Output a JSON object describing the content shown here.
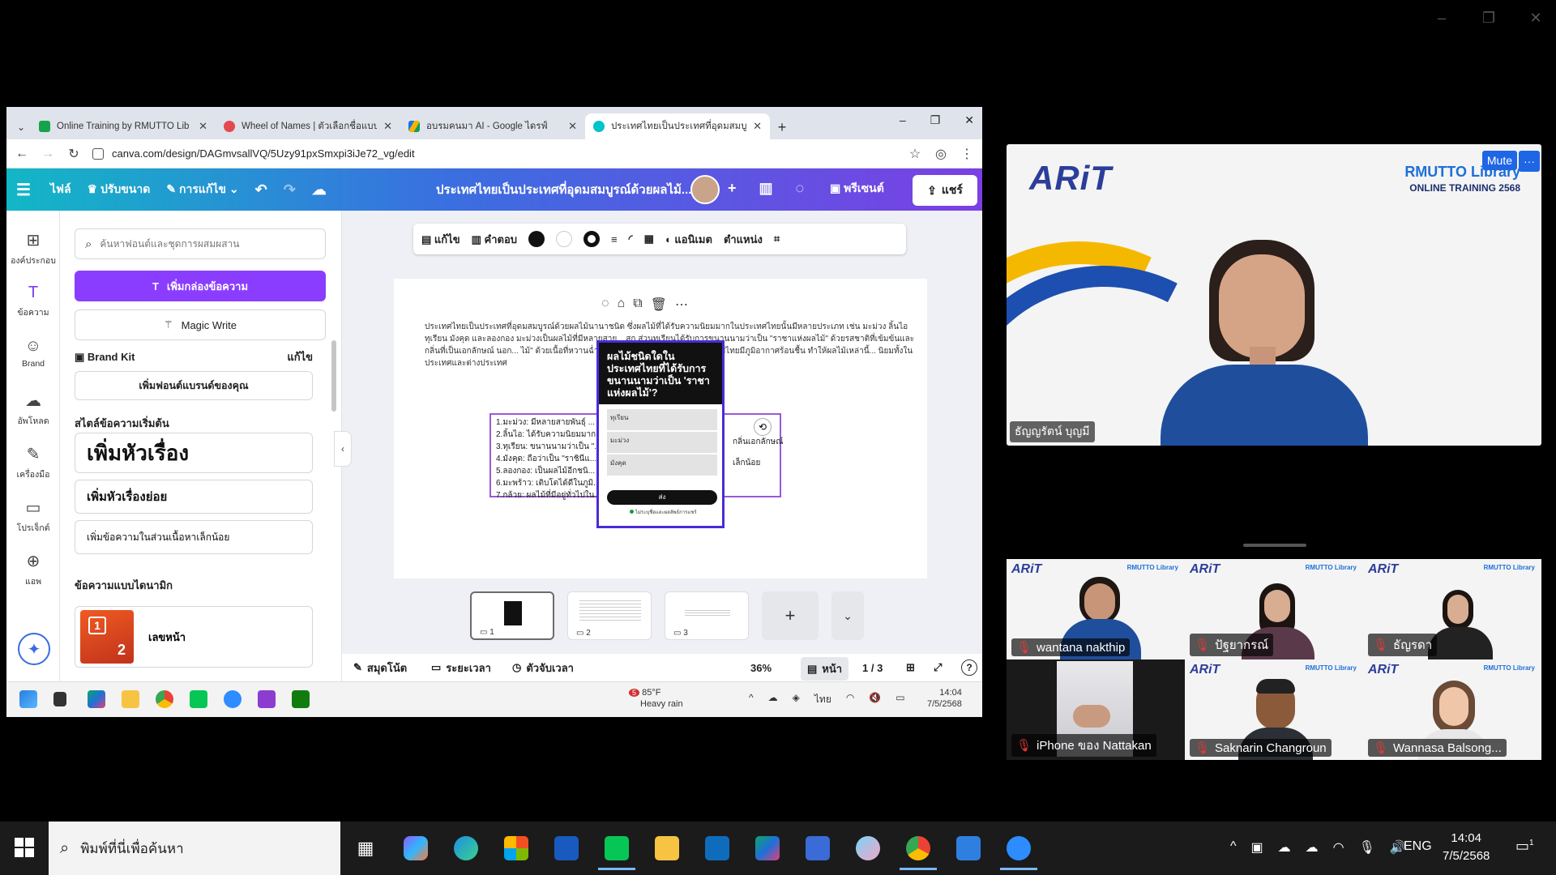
{
  "outer_window": {
    "controls": [
      "–",
      "❐",
      "✕"
    ]
  },
  "browser": {
    "tabs": [
      {
        "title": "Online Training by RMUTTO Lib",
        "color": "#16a34a"
      },
      {
        "title": "Wheel of Names | ตัวเลือกชื่อแบบ",
        "color": "#e5484d"
      },
      {
        "title": "อบรมคนมา AI - Google ไดรฟ์",
        "color": "#f4b400"
      },
      {
        "title": "ประเทศไทยเป็นประเทศที่อุดมสมบูรณ์",
        "color": "#00c4cc"
      }
    ],
    "new_tab": "+",
    "window_controls": [
      "–",
      "❐",
      "✕"
    ],
    "url": "canva.com/design/DAGmvsallVQ/5Uzy91pxSmxpi3iJe72_vg/edit"
  },
  "canva": {
    "header": {
      "menu": "☰",
      "file": "ไฟล์",
      "resize": "ปรับขนาด",
      "edit": "การแก้ไข",
      "doc_title": "ประเทศไทยเป็นประเทศที่อุดมสมบูรณ์ด้วยผลไม้...",
      "add": "+",
      "present": "พรีเซนต์",
      "share": "แชร์"
    },
    "rail": [
      {
        "icon": "⊞",
        "label": "องค์ประกอบ"
      },
      {
        "icon": "T",
        "label": "ข้อความ"
      },
      {
        "icon": "☺",
        "label": "Brand"
      },
      {
        "icon": "☁",
        "label": "อัพโหลด"
      },
      {
        "icon": "✎",
        "label": "เครื่องมือ"
      },
      {
        "icon": "▭",
        "label": "โปรเจ็กต์"
      },
      {
        "icon": "⊕",
        "label": "แอพ"
      }
    ],
    "panel": {
      "search_placeholder": "ค้นหาฟอนต์และชุดการผสมผสาน",
      "add_textbox": "เพิ่มกล่องข้อความ",
      "magic_write": "Magic Write",
      "brand_kit": "Brand Kit",
      "brand_kit_edit": "แก้ไข",
      "add_brand_font": "เพิ่มฟอนต์แบรนด์ของคุณ",
      "default_styles": "สไตล์ข้อความเริ่มต้น",
      "heading": "เพิ่มหัวเรื่อง",
      "subheading": "เพิ่มหัวเรื่องย่อย",
      "body": "เพิ่มข้อความในส่วนเนื้อหาเล็กน้อย",
      "dynamic_text": "ข้อความแบบไดนามิก",
      "page_number": "เลขหน้า",
      "thumb_num_1": "1",
      "thumb_num_2": "2"
    },
    "toolbar": {
      "edit": "แก้ไข",
      "answers": "คำตอบ",
      "animate": "แอนิเมต",
      "position": "ตำแหน่ง"
    },
    "page": {
      "paragraph": "ประเทศไทยเป็นประเทศที่อุดมสมบูรณ์ด้วยผลไม้นานาชนิด ซึ่งผลไม้ที่ได้รับความนิยมมากในประเทศไทยนั้นมีหลายประเภท เช่น มะม่วง ลิ้นไอ ทุเรียน มังคุด และลองกอง มะม่วงเป็นผลไม้ที่มีหลายสาย... สุก ส่วนทุเรียนได้รับการขนานนามว่าเป็น \"ราชาแห่งผลไม้\" ด้วยรสชาติที่เข้มข้นและกลิ่นที่เป็นเอกลักษณ์ นอก... ไม้\" ด้วยเนื้อที่หวานฉ่ำและมีรสเปรี้ยวเล็กน้อย การที่ประเทศไทยมีภูมิอากาศร้อนชื้น ทำให้ผลไม้เหล่านี้... นิยมทั้งในประเทศและต่างประเทศ",
      "list": [
        "1.มะม่วง: มีหลายสายพันธุ์ ...",
        "2.ลิ้นไอ: ได้รับความนิยมมาก...",
        "3.ทุเรียน: ขนานนามว่าเป็น \"...",
        "4.มังคุด: ถือว่าเป็น \"ราชินีแ...",
        "5.ลองกอง: เป็นผลไม้อีกชนิ...",
        "6.มะพร้าว: เติบโตได้ดีในภูมิ...",
        "7.กล้วย: ผลไม้ที่มีอยู่ทั่วไปใน..."
      ],
      "list_extra_1": "กลิ่นเอกลักษณ์",
      "list_extra_2": "เล็กน้อย",
      "form_title": "ผลไม้ชนิดใดในประเทศไทยที่ได้รับการขนานนามว่าเป็น 'ราชาแห่งผลไม้'?",
      "form_options": [
        "ทุเรียน",
        "มะม่วง",
        "มังคุด"
      ],
      "form_submit": "ส่ง",
      "form_footer": "ไม่ระบุชื่อและผลลัพธ์การแชร์"
    },
    "thumbnails": [
      {
        "num": "1"
      },
      {
        "num": "2"
      },
      {
        "num": "3"
      }
    ],
    "footer": {
      "notes": "สมุดโน้ต",
      "duration": "ระยะเวลา",
      "timer": "ตัวจับเวลา",
      "zoom": "36%",
      "pages_label": "หน้า",
      "page_count": "1 / 3",
      "help": "?"
    }
  },
  "inner_taskbar": {
    "weather_temp": "85°F",
    "weather_desc": "Heavy rain",
    "weather_badge": "5",
    "lang": "ไทย",
    "time": "14:04",
    "date": "7/5/2568"
  },
  "zoom": {
    "banner_logo": "ARiT",
    "banner_line1": "RMUTTO Library",
    "banner_line2": "ONLINE TRAINING 2568",
    "mute": "Mute",
    "more": "···",
    "speaker_name": "ธัญญรัตน์ บุญมี",
    "participants": [
      {
        "name": "wantana nakthip"
      },
      {
        "name": "ปัฐยากรณ์"
      },
      {
        "name": "ธัญรดา"
      },
      {
        "name": "iPhone ของ Nattakan"
      },
      {
        "name": "Saknarin Changroun"
      },
      {
        "name": "Wannasa Balsong..."
      }
    ]
  },
  "taskbar": {
    "search_placeholder": "พิมพ์ที่นี่เพื่อค้นหา",
    "lang": "ENG",
    "time": "14:04",
    "date": "7/5/2568",
    "notif_count": "1"
  }
}
